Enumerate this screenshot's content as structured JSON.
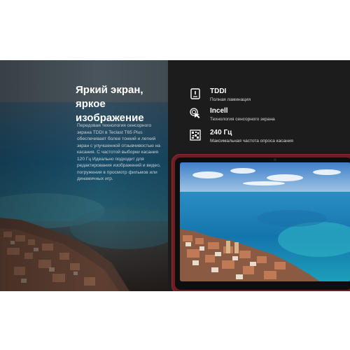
{
  "headline": {
    "line1": "Яркий экран,",
    "line2": "яркое изображение"
  },
  "description": "Передовая технология сенсорного экрана TDDI в Teclast T65 Plus обеспечивает более тонкий и легкий экран с улучшенной отзывчивостью на касания. С частотой выборки касания 120 Гц Идеально подходит для редактирования изображений и видео, погружения в просмотр фильмов или динамичных игр.",
  "features": [
    {
      "icon": "screen-layers-icon",
      "title": "TDDI",
      "subtitle": "Полная ламинация"
    },
    {
      "icon": "touch-hand-icon",
      "title": "Incell",
      "subtitle": "Технология сенсорного экрана"
    },
    {
      "icon": "frequency-grid-icon",
      "title": "240 Гц",
      "subtitle": "Максимальная частота опроса касания"
    }
  ],
  "colors": {
    "background": "#ffffff",
    "panel_dark": "#1c1c1c",
    "tablet_frame": "#6e1d24",
    "text_primary": "#ffffff"
  }
}
